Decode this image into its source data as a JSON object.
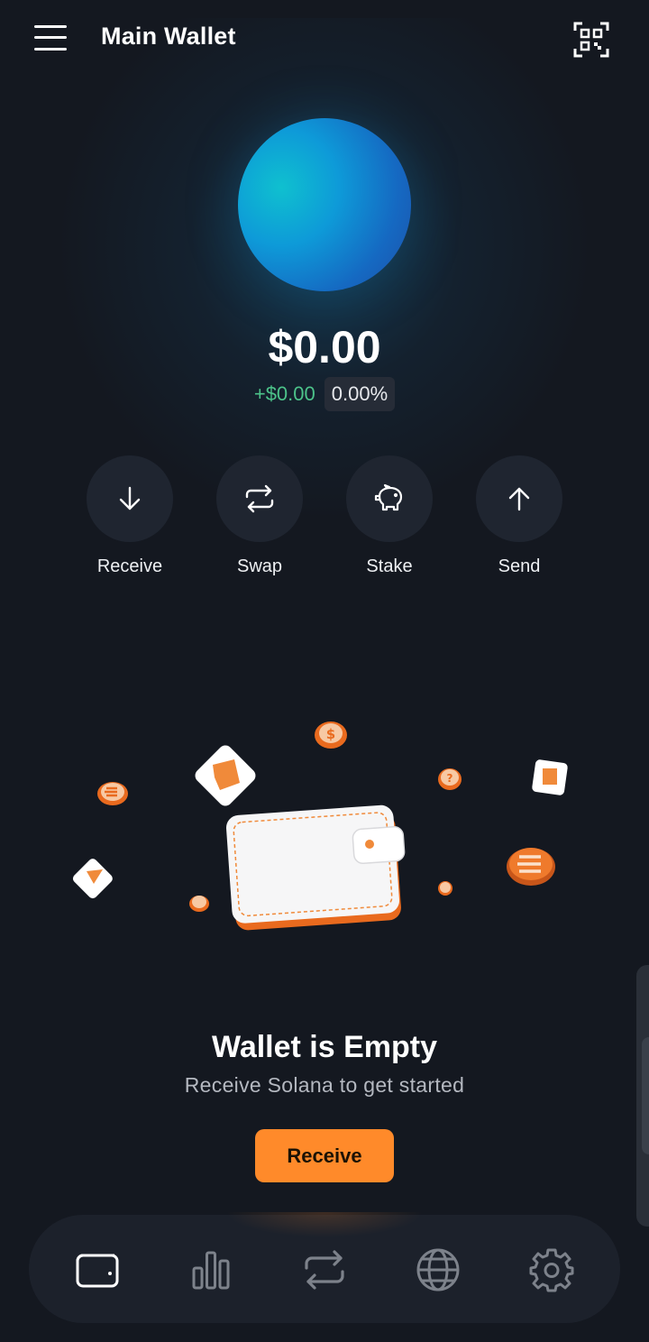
{
  "header": {
    "title": "Main Wallet",
    "menu_icon": "hamburger-menu-icon",
    "qr_icon": "qr-scan-icon"
  },
  "portfolio": {
    "balance": "$0.00",
    "change_usd": "+$0.00",
    "change_percent": "0.00%"
  },
  "actions": [
    {
      "label": "Receive",
      "icon": "arrow-down-icon"
    },
    {
      "label": "Swap",
      "icon": "swap-arrows-icon"
    },
    {
      "label": "Stake",
      "icon": "piggy-bank-icon"
    },
    {
      "label": "Send",
      "icon": "arrow-up-icon"
    }
  ],
  "empty_state": {
    "title": "Wallet is Empty",
    "subtitle": "Receive Solana to get started",
    "button_label": "Receive"
  },
  "bottom_nav": [
    {
      "icon": "wallet-icon",
      "active": true
    },
    {
      "icon": "bar-chart-icon",
      "active": false
    },
    {
      "icon": "swap-arrows-icon",
      "active": false
    },
    {
      "icon": "globe-icon",
      "active": false
    },
    {
      "icon": "gear-icon",
      "active": false
    }
  ],
  "colors": {
    "background": "#141820",
    "accent": "#ff8a2a",
    "positive": "#4cc38a",
    "action_circle": "#1f2530"
  }
}
